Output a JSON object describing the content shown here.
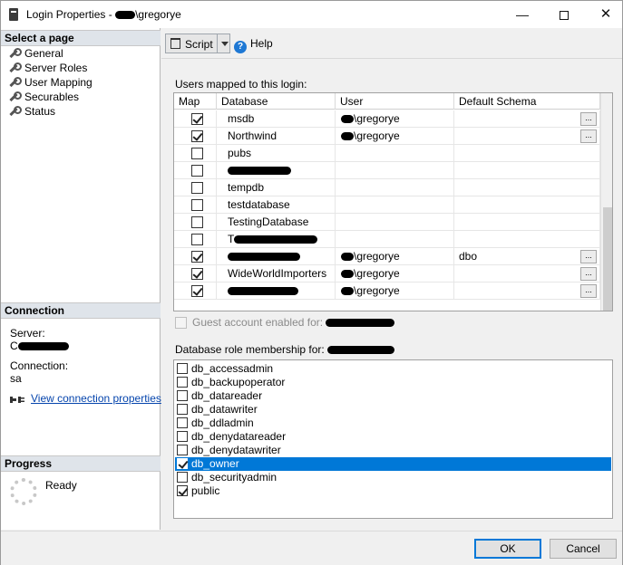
{
  "window": {
    "title_prefix": "Login Properties - ",
    "title_suffix": "\\gregorye"
  },
  "left_pane": {
    "select_page_header": "Select a page",
    "pages": [
      {
        "label": "General",
        "selected": false
      },
      {
        "label": "Server Roles",
        "selected": false
      },
      {
        "label": "User Mapping",
        "selected": true
      },
      {
        "label": "Securables",
        "selected": false
      },
      {
        "label": "Status",
        "selected": false
      }
    ],
    "connection_header": "Connection",
    "server_label": "Server:",
    "server_value_visible": "C",
    "connection_label": "Connection:",
    "connection_value": "sa",
    "view_connection_properties": "View connection properties",
    "progress_header": "Progress",
    "progress_status": "Ready"
  },
  "toolbar": {
    "script_label": "Script",
    "help_label": "Help"
  },
  "users_mapped": {
    "label": "Users mapped to this login:",
    "columns": [
      "Map",
      "Database",
      "User",
      "Default Schema"
    ],
    "rows": [
      {
        "checked": true,
        "database": "msdb",
        "user": "\\gregorye",
        "user_redacted": true,
        "schema": "",
        "has_button": true
      },
      {
        "checked": true,
        "database": "Northwind",
        "user": "\\gregorye",
        "user_redacted": true,
        "schema": "",
        "has_button": true
      },
      {
        "checked": false,
        "database": "pubs",
        "user": "",
        "schema": "",
        "has_button": false
      },
      {
        "checked": false,
        "database": "",
        "database_redacted": true,
        "user": "",
        "schema": "",
        "has_button": false
      },
      {
        "checked": false,
        "database": "tempdb",
        "user": "",
        "schema": "",
        "has_button": false
      },
      {
        "checked": false,
        "database": "testdatabase",
        "user": "",
        "schema": "",
        "has_button": false
      },
      {
        "checked": false,
        "database": "TestingDatabase",
        "user": "",
        "schema": "",
        "has_button": false
      },
      {
        "checked": false,
        "database": "T",
        "database_redacted": true,
        "user": "",
        "schema": "",
        "has_button": false
      },
      {
        "checked": true,
        "database": "",
        "database_redacted": true,
        "user": "\\gregorye",
        "user_redacted": true,
        "schema": "dbo",
        "has_button": true
      },
      {
        "checked": true,
        "database": "WideWorldImporters",
        "user": "\\gregorye",
        "user_redacted": true,
        "schema": "",
        "has_button": true
      },
      {
        "checked": true,
        "database": "",
        "database_redacted": true,
        "user": "\\gregorye",
        "user_redacted": true,
        "schema": "",
        "has_button": true
      }
    ],
    "ellipsis_label": "..."
  },
  "guest": {
    "label": "Guest account enabled for: "
  },
  "role_membership": {
    "label": "Database role membership for: ",
    "roles": [
      {
        "name": "db_accessadmin",
        "checked": false,
        "selected": false
      },
      {
        "name": "db_backupoperator",
        "checked": false,
        "selected": false
      },
      {
        "name": "db_datareader",
        "checked": false,
        "selected": false
      },
      {
        "name": "db_datawriter",
        "checked": false,
        "selected": false
      },
      {
        "name": "db_ddladmin",
        "checked": false,
        "selected": false
      },
      {
        "name": "db_denydatareader",
        "checked": false,
        "selected": false
      },
      {
        "name": "db_denydatawriter",
        "checked": false,
        "selected": false
      },
      {
        "name": "db_owner",
        "checked": true,
        "selected": true
      },
      {
        "name": "db_securityadmin",
        "checked": false,
        "selected": false
      },
      {
        "name": "public",
        "checked": true,
        "selected": false
      }
    ]
  },
  "footer": {
    "ok_label": "OK",
    "cancel_label": "Cancel"
  },
  "colors": {
    "selection": "#0078d7",
    "link": "#0645ad",
    "section_header": "#dfe4ea"
  }
}
